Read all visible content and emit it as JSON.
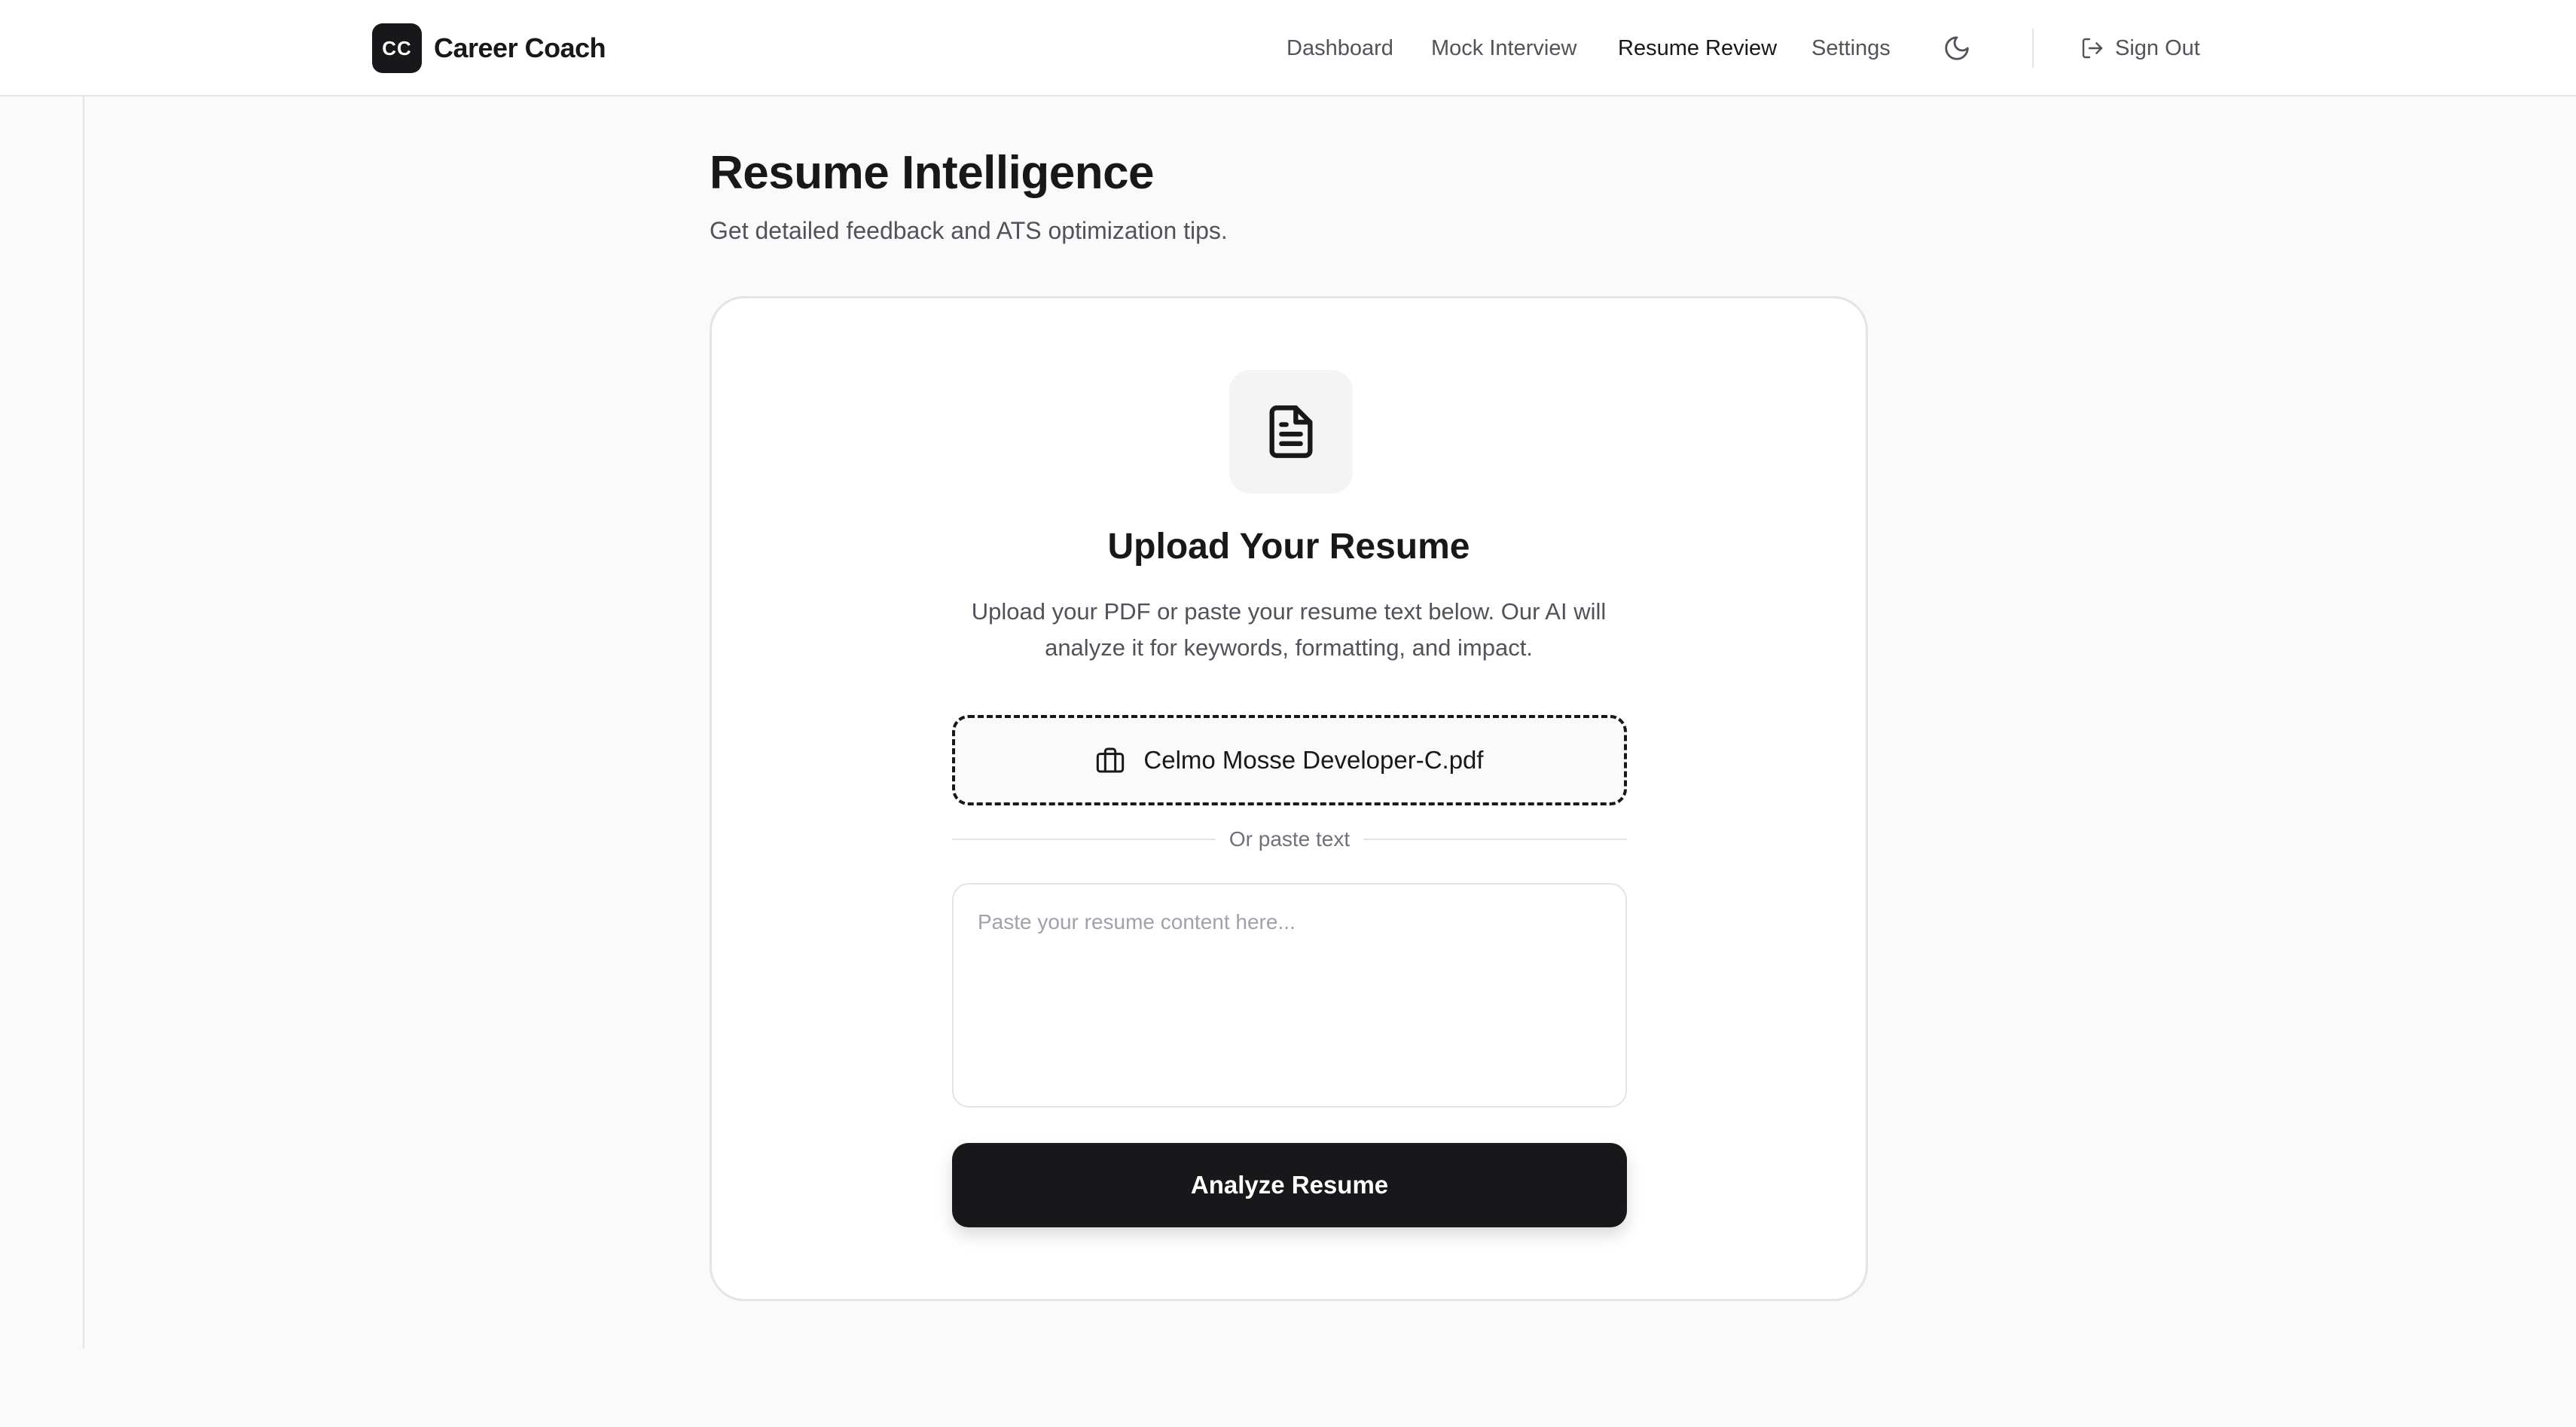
{
  "header": {
    "logo_text": "CC",
    "app_name": "Career Coach",
    "nav": [
      {
        "label": "Dashboard"
      },
      {
        "label": "Mock Interview"
      },
      {
        "label": "Resume Review"
      },
      {
        "label": "Settings"
      }
    ],
    "active_nav": "Resume Review",
    "theme_icon": "moon-icon",
    "sign_out_label": "Sign Out",
    "sign_out_icon": "sign-out-icon"
  },
  "page": {
    "title": "Resume Intelligence",
    "subtitle": "Get detailed feedback and ATS optimization tips."
  },
  "card": {
    "icon": "document-icon",
    "title": "Upload Your Resume",
    "description": "Upload your PDF or paste your resume text below. Our AI will analyze it for keywords, formatting, and impact.",
    "upload": {
      "icon": "briefcase-icon",
      "filename": "Celmo Mosse Developer-C.pdf"
    },
    "divider_text": "Or paste text",
    "paste": {
      "value": "",
      "placeholder": "Paste your resume content here..."
    },
    "analyze_label": "Analyze Resume"
  },
  "colors": {
    "primary": "#18181b",
    "background": "#fafafa",
    "border": "#e4e4e7",
    "muted_text": "#52525b"
  }
}
